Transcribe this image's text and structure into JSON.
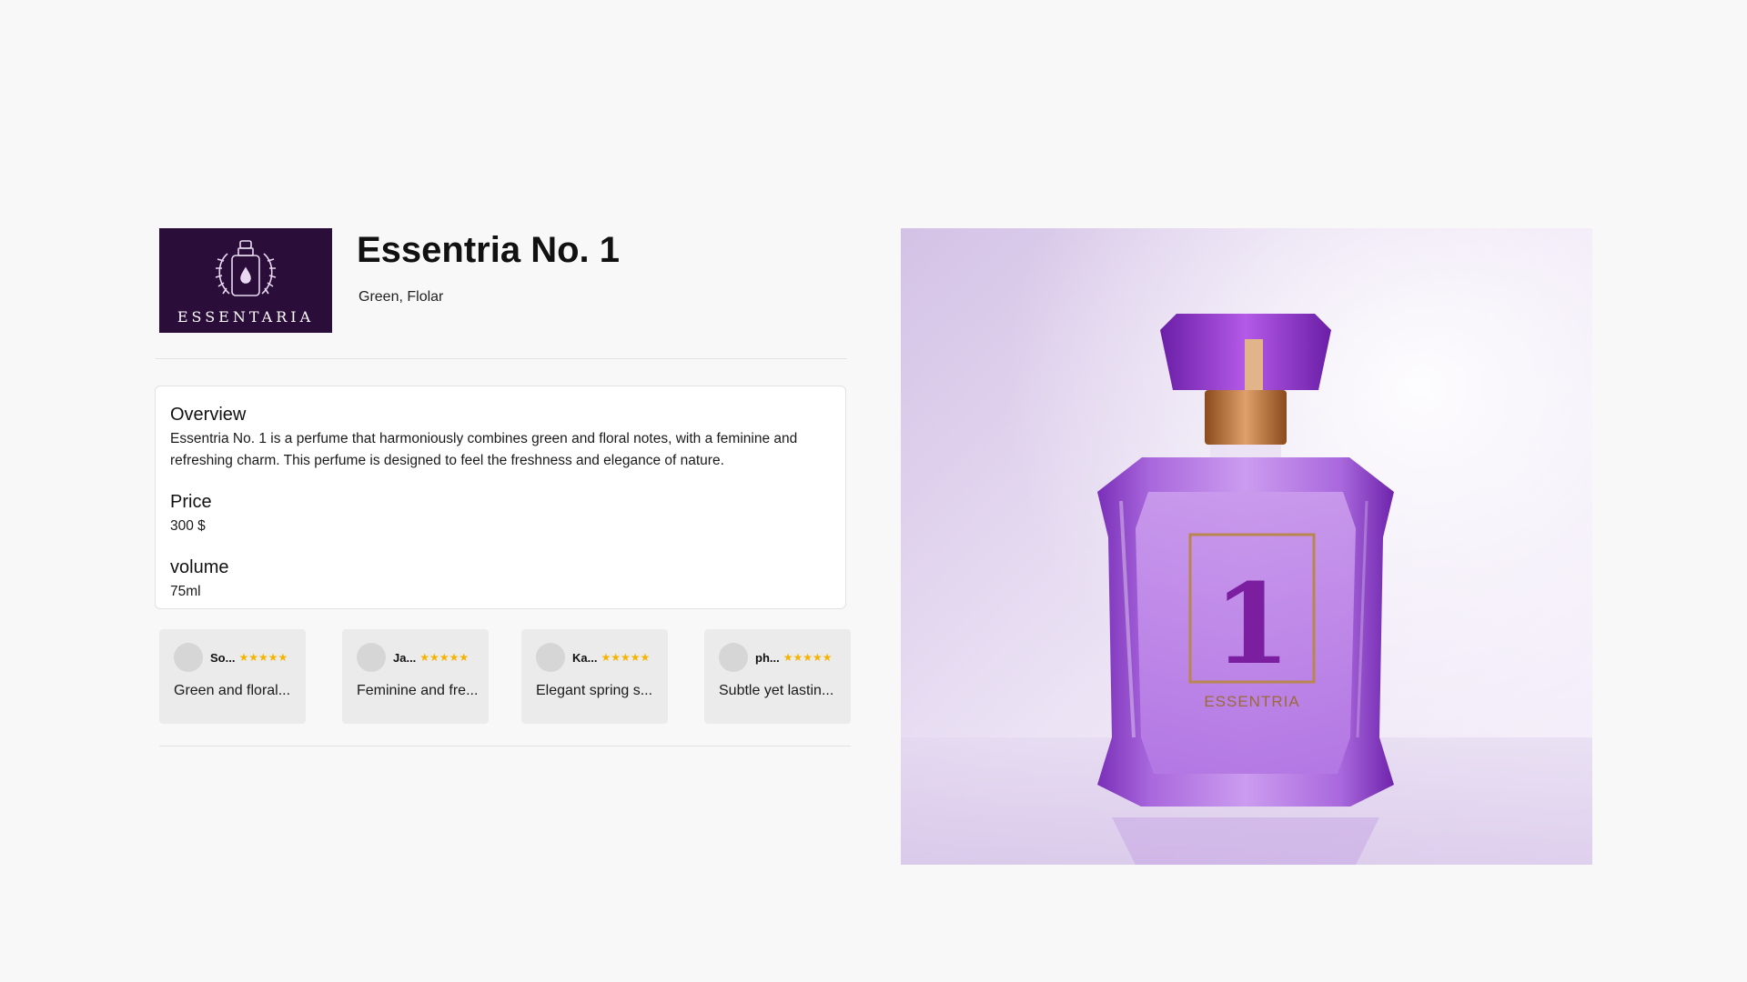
{
  "brand": {
    "logo_text": "ESSENTARIA",
    "logo_bg": "#2b0d3a"
  },
  "product": {
    "title": "Essentria No. 1",
    "tags": "Green, Flolar",
    "bottle_label": "ESSENTRIA",
    "bottle_number": "1"
  },
  "details": {
    "overview": {
      "heading": "Overview",
      "text": "Essentria No. 1 is a perfume that harmoniously combines green and floral notes, with a feminine and refreshing charm. This perfume is designed to feel the freshness and elegance of nature."
    },
    "price": {
      "heading": "Price",
      "value": "300 $"
    },
    "volume": {
      "heading": "volume",
      "value": "75ml"
    }
  },
  "reviews": [
    {
      "name": "So...",
      "stars": "★★★★★",
      "text": "Green and floral..."
    },
    {
      "name": "Ja...",
      "stars": "★★★★★",
      "text": "Feminine and fre..."
    },
    {
      "name": "Ka...",
      "stars": "★★★★★",
      "text": "Elegant spring s..."
    },
    {
      "name": "ph...",
      "stars": "★★★★★",
      "text": "Subtle yet lastin..."
    }
  ],
  "colors": {
    "star": "#f5b400",
    "accent_purple": "#9b3fd0"
  },
  "icons": {
    "logo": "perfume-bottle-wreath-icon"
  }
}
